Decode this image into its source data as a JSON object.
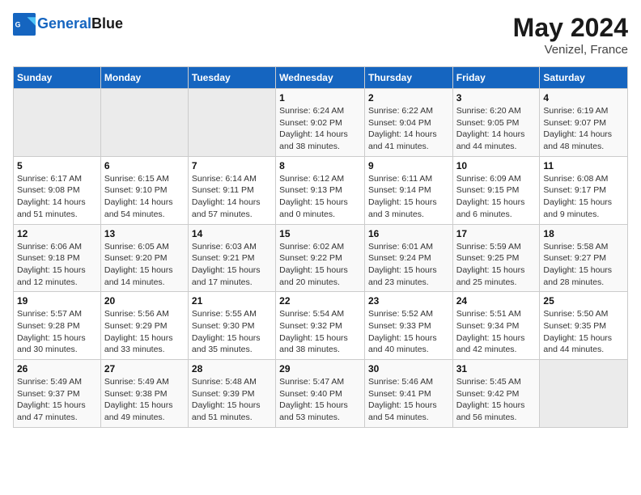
{
  "header": {
    "logo_line1": "General",
    "logo_line2": "Blue",
    "month": "May 2024",
    "location": "Venizel, France"
  },
  "weekdays": [
    "Sunday",
    "Monday",
    "Tuesday",
    "Wednesday",
    "Thursday",
    "Friday",
    "Saturday"
  ],
  "weeks": [
    [
      {
        "day": "",
        "info": ""
      },
      {
        "day": "",
        "info": ""
      },
      {
        "day": "",
        "info": ""
      },
      {
        "day": "1",
        "info": "Sunrise: 6:24 AM\nSunset: 9:02 PM\nDaylight: 14 hours and 38 minutes."
      },
      {
        "day": "2",
        "info": "Sunrise: 6:22 AM\nSunset: 9:04 PM\nDaylight: 14 hours and 41 minutes."
      },
      {
        "day": "3",
        "info": "Sunrise: 6:20 AM\nSunset: 9:05 PM\nDaylight: 14 hours and 44 minutes."
      },
      {
        "day": "4",
        "info": "Sunrise: 6:19 AM\nSunset: 9:07 PM\nDaylight: 14 hours and 48 minutes."
      }
    ],
    [
      {
        "day": "5",
        "info": "Sunrise: 6:17 AM\nSunset: 9:08 PM\nDaylight: 14 hours and 51 minutes."
      },
      {
        "day": "6",
        "info": "Sunrise: 6:15 AM\nSunset: 9:10 PM\nDaylight: 14 hours and 54 minutes."
      },
      {
        "day": "7",
        "info": "Sunrise: 6:14 AM\nSunset: 9:11 PM\nDaylight: 14 hours and 57 minutes."
      },
      {
        "day": "8",
        "info": "Sunrise: 6:12 AM\nSunset: 9:13 PM\nDaylight: 15 hours and 0 minutes."
      },
      {
        "day": "9",
        "info": "Sunrise: 6:11 AM\nSunset: 9:14 PM\nDaylight: 15 hours and 3 minutes."
      },
      {
        "day": "10",
        "info": "Sunrise: 6:09 AM\nSunset: 9:15 PM\nDaylight: 15 hours and 6 minutes."
      },
      {
        "day": "11",
        "info": "Sunrise: 6:08 AM\nSunset: 9:17 PM\nDaylight: 15 hours and 9 minutes."
      }
    ],
    [
      {
        "day": "12",
        "info": "Sunrise: 6:06 AM\nSunset: 9:18 PM\nDaylight: 15 hours and 12 minutes."
      },
      {
        "day": "13",
        "info": "Sunrise: 6:05 AM\nSunset: 9:20 PM\nDaylight: 15 hours and 14 minutes."
      },
      {
        "day": "14",
        "info": "Sunrise: 6:03 AM\nSunset: 9:21 PM\nDaylight: 15 hours and 17 minutes."
      },
      {
        "day": "15",
        "info": "Sunrise: 6:02 AM\nSunset: 9:22 PM\nDaylight: 15 hours and 20 minutes."
      },
      {
        "day": "16",
        "info": "Sunrise: 6:01 AM\nSunset: 9:24 PM\nDaylight: 15 hours and 23 minutes."
      },
      {
        "day": "17",
        "info": "Sunrise: 5:59 AM\nSunset: 9:25 PM\nDaylight: 15 hours and 25 minutes."
      },
      {
        "day": "18",
        "info": "Sunrise: 5:58 AM\nSunset: 9:27 PM\nDaylight: 15 hours and 28 minutes."
      }
    ],
    [
      {
        "day": "19",
        "info": "Sunrise: 5:57 AM\nSunset: 9:28 PM\nDaylight: 15 hours and 30 minutes."
      },
      {
        "day": "20",
        "info": "Sunrise: 5:56 AM\nSunset: 9:29 PM\nDaylight: 15 hours and 33 minutes."
      },
      {
        "day": "21",
        "info": "Sunrise: 5:55 AM\nSunset: 9:30 PM\nDaylight: 15 hours and 35 minutes."
      },
      {
        "day": "22",
        "info": "Sunrise: 5:54 AM\nSunset: 9:32 PM\nDaylight: 15 hours and 38 minutes."
      },
      {
        "day": "23",
        "info": "Sunrise: 5:52 AM\nSunset: 9:33 PM\nDaylight: 15 hours and 40 minutes."
      },
      {
        "day": "24",
        "info": "Sunrise: 5:51 AM\nSunset: 9:34 PM\nDaylight: 15 hours and 42 minutes."
      },
      {
        "day": "25",
        "info": "Sunrise: 5:50 AM\nSunset: 9:35 PM\nDaylight: 15 hours and 44 minutes."
      }
    ],
    [
      {
        "day": "26",
        "info": "Sunrise: 5:49 AM\nSunset: 9:37 PM\nDaylight: 15 hours and 47 minutes."
      },
      {
        "day": "27",
        "info": "Sunrise: 5:49 AM\nSunset: 9:38 PM\nDaylight: 15 hours and 49 minutes."
      },
      {
        "day": "28",
        "info": "Sunrise: 5:48 AM\nSunset: 9:39 PM\nDaylight: 15 hours and 51 minutes."
      },
      {
        "day": "29",
        "info": "Sunrise: 5:47 AM\nSunset: 9:40 PM\nDaylight: 15 hours and 53 minutes."
      },
      {
        "day": "30",
        "info": "Sunrise: 5:46 AM\nSunset: 9:41 PM\nDaylight: 15 hours and 54 minutes."
      },
      {
        "day": "31",
        "info": "Sunrise: 5:45 AM\nSunset: 9:42 PM\nDaylight: 15 hours and 56 minutes."
      },
      {
        "day": "",
        "info": ""
      }
    ]
  ]
}
